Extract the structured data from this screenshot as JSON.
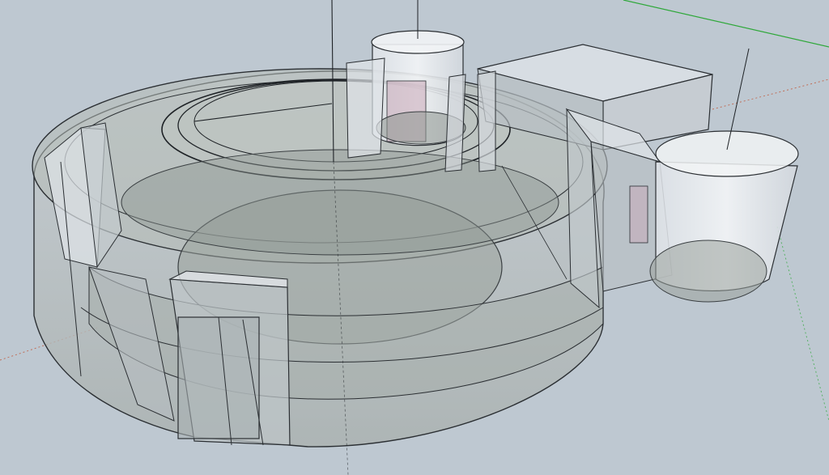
{
  "viewport": {
    "background": "#bcc6cf",
    "ground_tint": "#aeb8b2"
  },
  "axes": {
    "red_axis_color": "#c0705a",
    "green_axis_color": "#2fa83a",
    "blue_axis_color": "#2a2a6a"
  },
  "model": {
    "material_fill": "#9aa29c",
    "edge_color": "#2b2f33",
    "glass_fill": "#e8ecef",
    "accent_pink": "#c8a8b8"
  }
}
